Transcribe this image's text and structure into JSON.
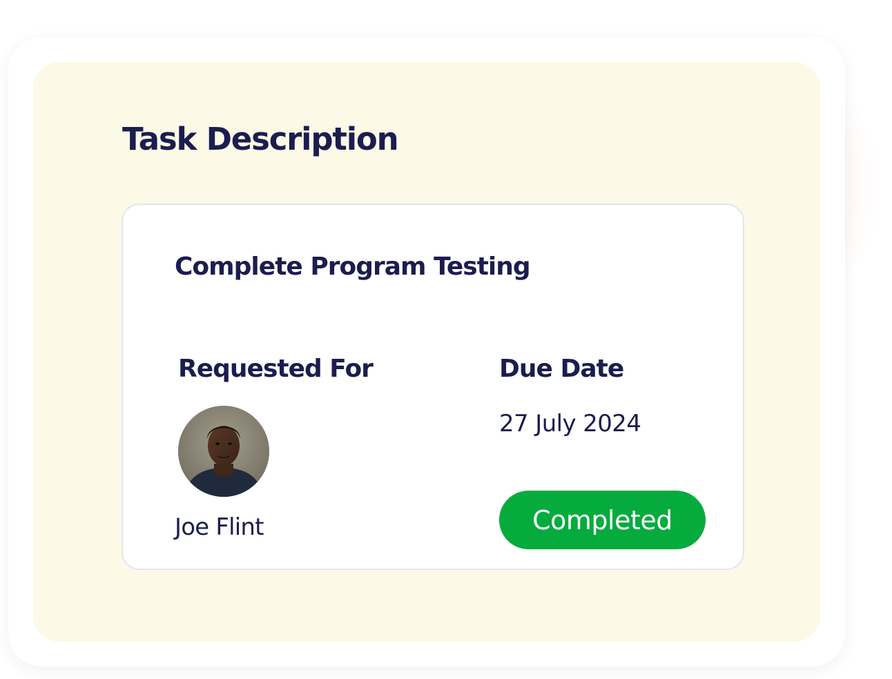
{
  "colors": {
    "panel_background": "#fdf9e7",
    "heading_text": "#1b1d4f",
    "status_completed": "#06ab3e"
  },
  "panel": {
    "title": "Task Description"
  },
  "task": {
    "name": "Complete Program Testing",
    "requested_for_label": "Requested For",
    "assignee_name": "Joe Flint",
    "due_date_label": "Due Date",
    "due_date": "27 July 2024",
    "status": "Completed"
  }
}
